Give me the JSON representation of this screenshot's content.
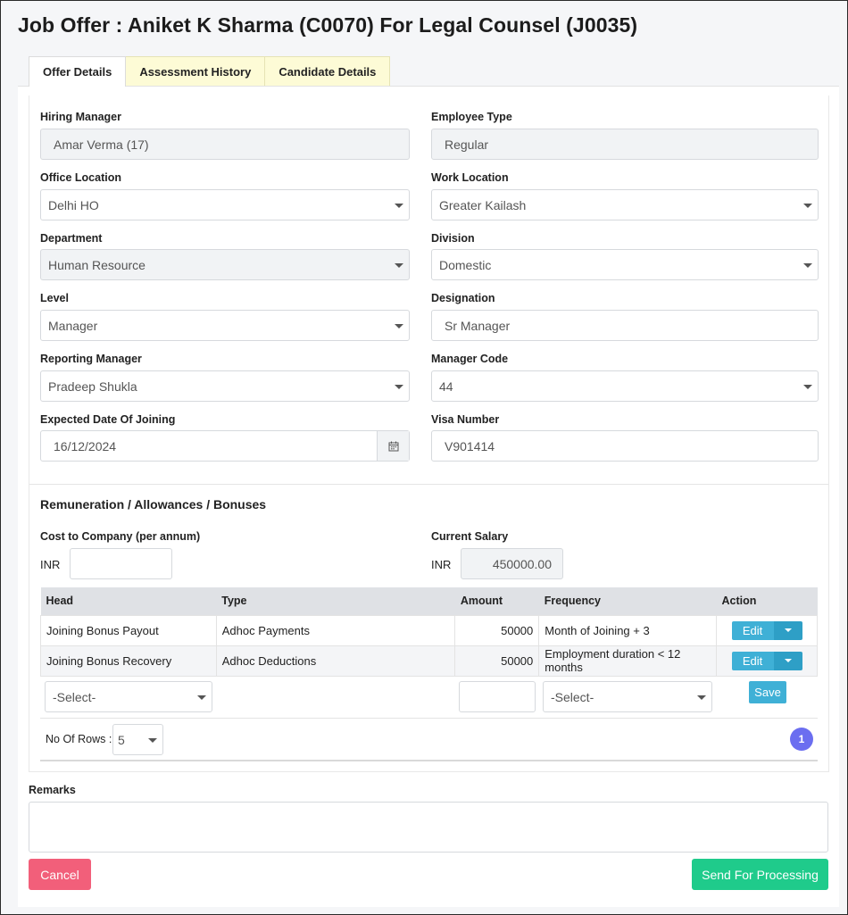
{
  "page": {
    "title": "Job Offer :  Aniket K Sharma (C0070) For Legal Counsel (J0035)"
  },
  "tabs": [
    {
      "label": "Offer Details",
      "active": true
    },
    {
      "label": "Assessment History",
      "active": false
    },
    {
      "label": "Candidate Details",
      "active": false
    }
  ],
  "form": {
    "hiring_manager": {
      "label": "Hiring Manager",
      "value": "Amar Verma (17)"
    },
    "employee_type": {
      "label": "Employee Type",
      "value": "Regular"
    },
    "office_location": {
      "label": "Office Location",
      "value": "Delhi HO"
    },
    "work_location": {
      "label": "Work Location",
      "value": "Greater Kailash"
    },
    "department": {
      "label": "Department",
      "value": "Human Resource"
    },
    "division": {
      "label": "Division",
      "value": "Domestic"
    },
    "level": {
      "label": "Level",
      "value": "Manager"
    },
    "designation": {
      "label": "Designation",
      "value": "Sr Manager"
    },
    "reporting_manager": {
      "label": "Reporting Manager",
      "value": "Pradeep Shukla"
    },
    "manager_code": {
      "label": "Manager Code",
      "value": "44"
    },
    "joining_date": {
      "label": "Expected Date Of Joining",
      "value": "16/12/2024"
    },
    "visa_number": {
      "label": "Visa Number",
      "value": "V901414"
    }
  },
  "remuneration": {
    "title": "Remuneration / Allowances / Bonuses",
    "ctc_label": "Cost to Company (per annum)",
    "ctc_currency": "INR",
    "ctc_value": "",
    "current_salary_label": "Current Salary",
    "current_salary_currency": "INR",
    "current_salary_value": "450000.00",
    "columns": [
      "Head",
      "Type",
      "Amount",
      "Frequency",
      "Action"
    ],
    "rows": [
      {
        "head": "Joining Bonus Payout",
        "type": "Adhoc Payments",
        "amount": "50000",
        "frequency": "Month of Joining + 3",
        "action": "Edit"
      },
      {
        "head": "Joining Bonus Recovery",
        "type": "Adhoc Deductions",
        "amount": "50000",
        "frequency": "Employment duration < 12 months",
        "action": "Edit"
      }
    ],
    "new_row": {
      "head_placeholder": "-Select-",
      "frequency_placeholder": "-Select-",
      "save_label": "Save"
    },
    "rows_label": "No Of Rows :",
    "rows_value": "5",
    "page": "1"
  },
  "remarks": {
    "label": "Remarks",
    "value": ""
  },
  "buttons": {
    "cancel": "Cancel",
    "send": "Send For Processing"
  },
  "colors": {
    "cancel": "#f25f7a",
    "send": "#1fcb8b",
    "edit": "#3fb0d6",
    "page_badge": "#6b6ef0",
    "tab_inactive": "#fdfbd6"
  }
}
